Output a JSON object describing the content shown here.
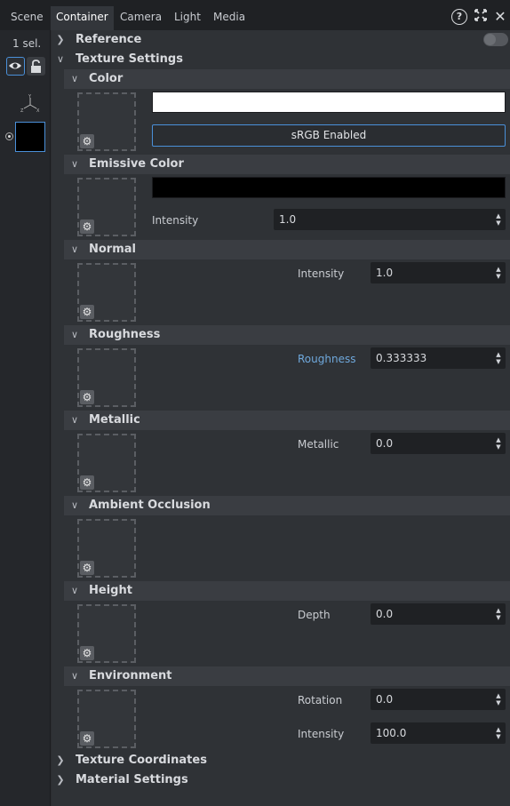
{
  "tabs": [
    "Scene",
    "Container",
    "Camera",
    "Light",
    "Media"
  ],
  "active_tab": "Container",
  "left": {
    "selection_label": "1 sel."
  },
  "sections": {
    "reference": "Reference",
    "texture_settings": "Texture Settings",
    "texture_coordinates": "Texture Coordinates",
    "material_settings": "Material Settings"
  },
  "subsections": {
    "color": {
      "label": "Color",
      "swatch": "#ffffff",
      "button": "sRGB Enabled"
    },
    "emissive": {
      "label": "Emissive Color",
      "swatch": "#000000",
      "intensity_label": "Intensity",
      "intensity_value": "1.0"
    },
    "normal": {
      "label": "Normal",
      "intensity_label": "Intensity",
      "intensity_value": "1.0"
    },
    "roughness": {
      "label": "Roughness",
      "param_label": "Roughness",
      "param_value": "0.333333"
    },
    "metallic": {
      "label": "Metallic",
      "param_label": "Metallic",
      "param_value": "0.0"
    },
    "ambient_occlusion": {
      "label": "Ambient Occlusion"
    },
    "height": {
      "label": "Height",
      "depth_label": "Depth",
      "depth_value": "0.0"
    },
    "environment": {
      "label": "Environment",
      "rotation_label": "Rotation",
      "rotation_value": "0.0",
      "intensity_label": "Intensity",
      "intensity_value": "100.0"
    }
  },
  "colors": {
    "accent": "#4a90d9",
    "accent_label": "#6fa8dc"
  }
}
